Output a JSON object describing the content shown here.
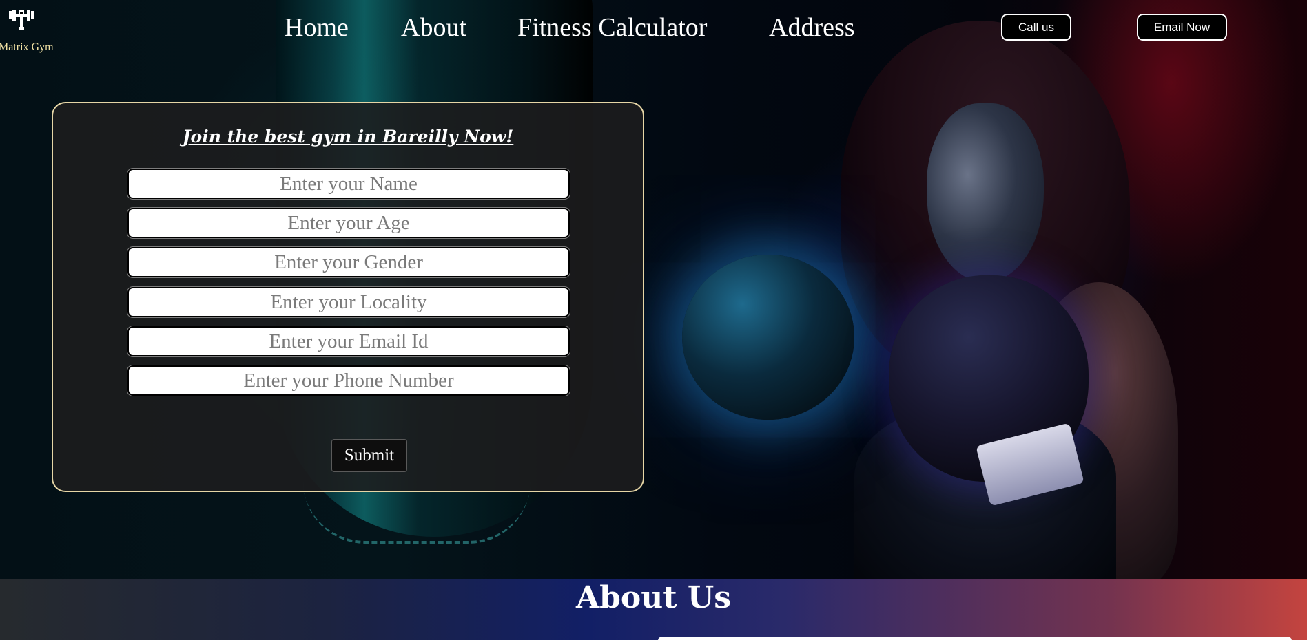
{
  "brand": {
    "logo_icon": "dumbbell-icon",
    "name": "Matrix Gym"
  },
  "nav": {
    "home": "Home",
    "about": "About",
    "fitness_calculator": "Fitness Calculator",
    "address": "Address"
  },
  "header_buttons": {
    "call": "Call us",
    "email": "Email Now"
  },
  "form": {
    "title": "Join the best gym in Bareilly Now!",
    "fields": {
      "name": "Enter your Name",
      "age": "Enter your Age",
      "gender": "Enter your Gender",
      "locality": "Enter your Locality",
      "email": "Enter your Email Id",
      "phone": "Enter your Phone Number"
    },
    "submit": "Submit"
  },
  "about": {
    "title": "About Us"
  },
  "colors": {
    "logo_text": "#f2e2a4",
    "card_border": "#e6d6a6",
    "about_gradient_start": "#262a2e",
    "about_gradient_mid": "#121f66",
    "about_gradient_end": "#c4443f"
  }
}
